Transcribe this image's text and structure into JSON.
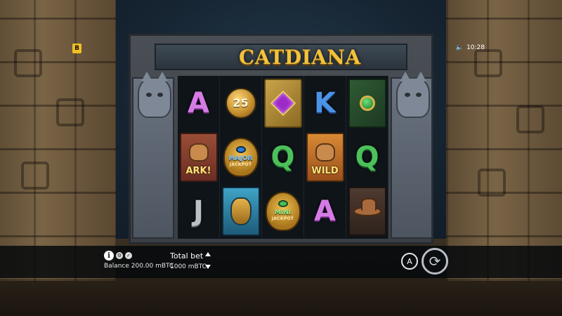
{
  "game": {
    "logo_text": "CATDIANA",
    "brand_badge": "B",
    "clock": "10:28",
    "sound_icon": "speaker-icon"
  },
  "reels": [
    [
      {
        "kind": "letter",
        "value": "A",
        "color": "#d67be6"
      },
      {
        "kind": "character",
        "label": "ARK!"
      },
      {
        "kind": "letter",
        "value": "J",
        "color": "#b8c0c8"
      }
    ],
    [
      {
        "kind": "coin",
        "value": "25"
      },
      {
        "kind": "jackpot",
        "line1": "MAJOR",
        "line2": "JACKPOT"
      },
      {
        "kind": "mask"
      }
    ],
    [
      {
        "kind": "gem",
        "gem": "purple"
      },
      {
        "kind": "letter",
        "value": "Q",
        "color": "#4cc05a"
      },
      {
        "kind": "jackpot",
        "line1": "MINI",
        "line2": "JACKPOT"
      }
    ],
    [
      {
        "kind": "letter",
        "value": "K",
        "color": "#4a93e6"
      },
      {
        "kind": "character",
        "label": "WILD"
      },
      {
        "kind": "letter",
        "value": "A",
        "color": "#d67be6"
      }
    ],
    [
      {
        "kind": "gem",
        "gem": "green"
      },
      {
        "kind": "letter",
        "value": "Q",
        "color": "#4cc05a"
      },
      {
        "kind": "hat"
      }
    ]
  ],
  "hud": {
    "info_icon": "i",
    "balance": "Balance 200.00 mBTC",
    "total_bet_label": "Total bet",
    "total_bet_value": "1000 mBTC",
    "auto_label": "A"
  }
}
